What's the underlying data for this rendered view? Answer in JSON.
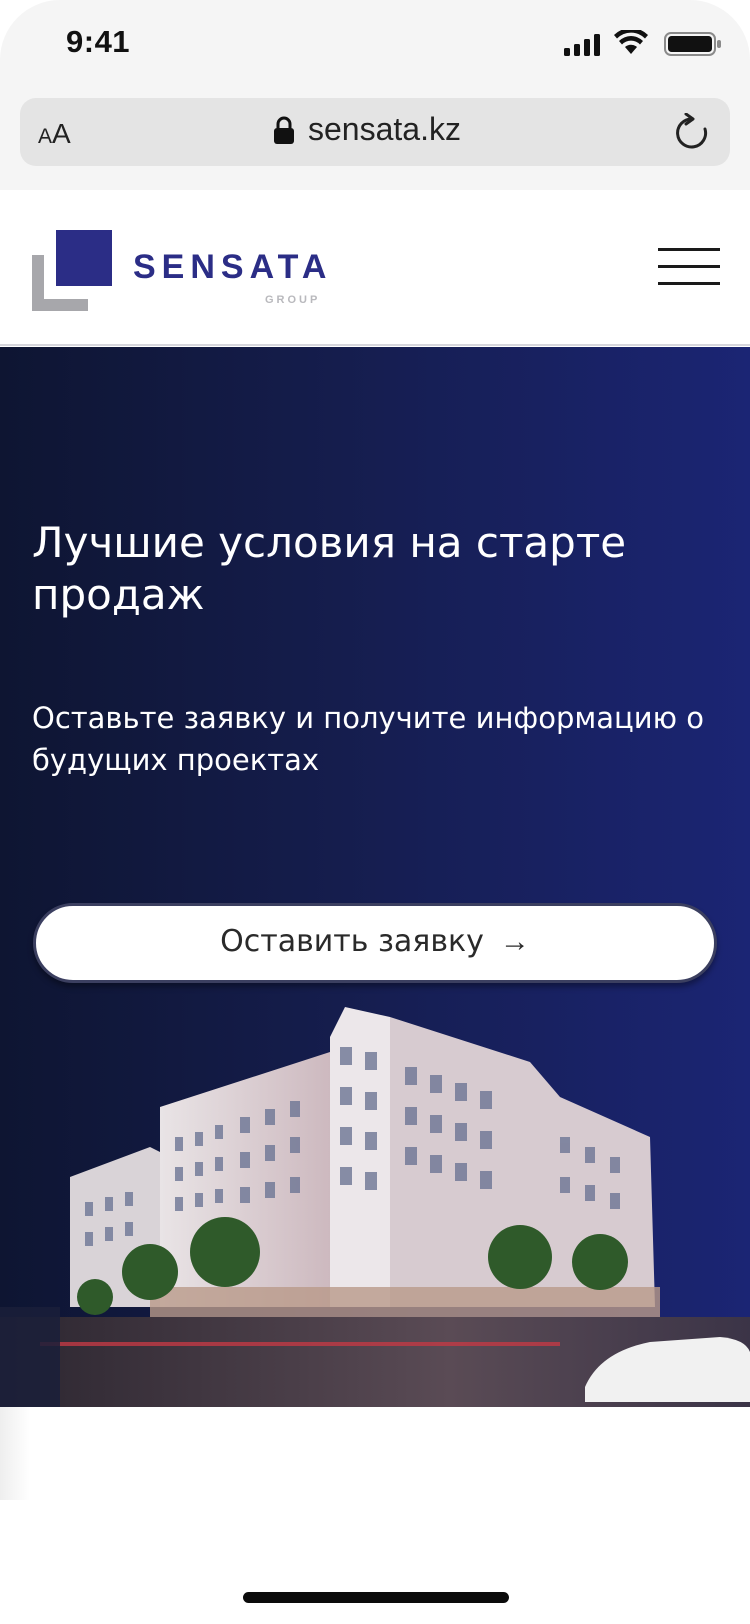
{
  "status_bar": {
    "time": "9:41",
    "icons": [
      "cellular-signal-icon",
      "wifi-icon",
      "battery-icon"
    ]
  },
  "browser": {
    "text_size_small": "A",
    "text_size_large": "A",
    "url": "sensata.kz",
    "lock_icon": "lock-icon",
    "reload_icon": "reload-icon"
  },
  "header": {
    "logo_name": "SENSATA",
    "logo_sub": "GROUP",
    "menu_icon": "hamburger-icon",
    "brand_color": "#2b2d86"
  },
  "hero": {
    "title": "Лучшие условия на старте продаж",
    "subtitle": "Оставьте заявку и получите информацию о будущих проектах",
    "cta_label": "Оставить заявку",
    "cta_arrow": "→",
    "background_colors": [
      "#0e1532",
      "#1b2574"
    ],
    "image": "residential-building-rendering"
  }
}
